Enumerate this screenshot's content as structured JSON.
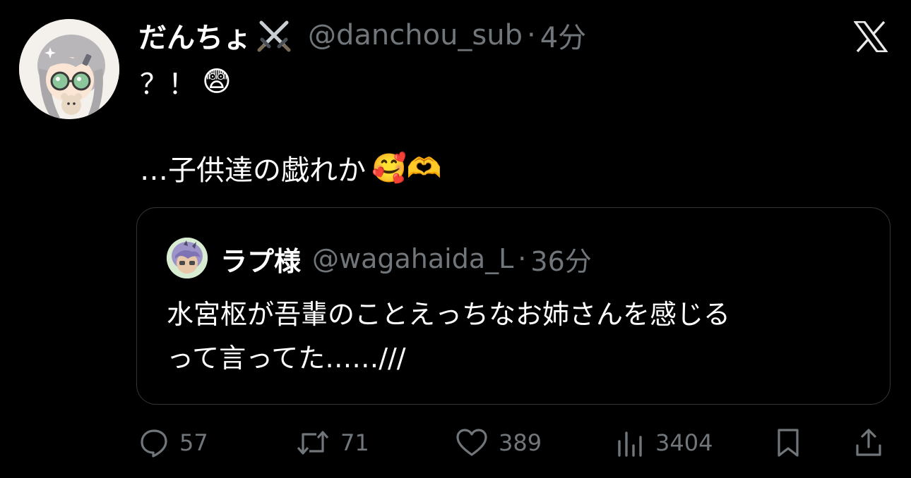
{
  "tweet": {
    "author": {
      "display_name": "だんちょ",
      "handle": "@danchou_sub",
      "badge_icon": "crossed-swords-icon"
    },
    "separator": "·",
    "time": "4分",
    "line1": "？！",
    "line1_emoji": "😨",
    "line2": "…子供達の戯れか",
    "line2_emoji": "🥰🫶"
  },
  "quote": {
    "author": {
      "display_name": "ラプ様",
      "handle": "@wagahaida_L"
    },
    "separator": "·",
    "time": "36分",
    "text_lines": [
      "水宮枢が吾輩のことえっちなお姉さんを感じる",
      "って言ってた……///"
    ]
  },
  "actions": {
    "replies": "57",
    "reposts": "71",
    "likes": "389",
    "views": "3404"
  },
  "colors": {
    "background": "#000000",
    "primary_text": "#ffffff",
    "secondary_text": "#71767b",
    "border": "#333639"
  }
}
